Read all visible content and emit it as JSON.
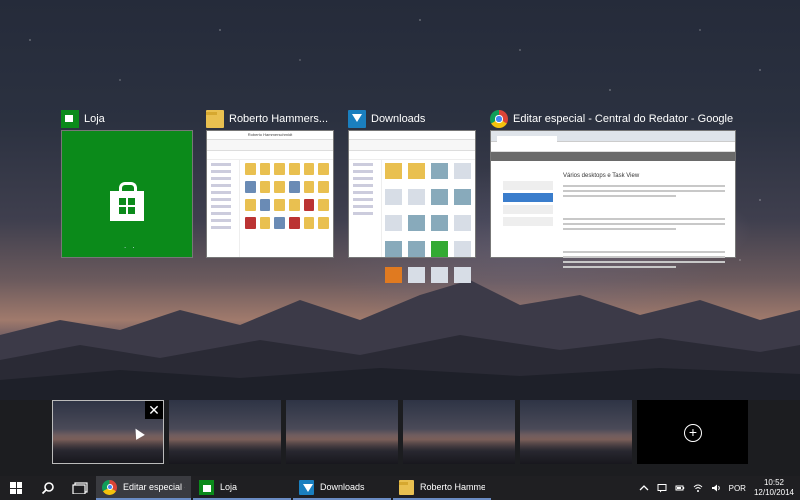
{
  "windows": [
    {
      "title": "Loja",
      "icon": "store-icon"
    },
    {
      "title": "Roberto Hammers...",
      "icon": "folder-icon",
      "window_title": "Roberto Hammerschmidt"
    },
    {
      "title": "Downloads",
      "icon": "downloads-folder-icon"
    },
    {
      "title": "Editar especial - Central do Redator - Google Ch...",
      "icon": "chrome-icon",
      "heading": "Vários desktops e Task View"
    }
  ],
  "desktops": {
    "count": 5,
    "active_index": 0,
    "close_symbol": "✕",
    "add_symbol": "+"
  },
  "taskbar": {
    "apps": [
      {
        "label": "Editar especial - C...",
        "icon": "chrome-icon",
        "active": true
      },
      {
        "label": "Loja",
        "icon": "store-icon",
        "active": false
      },
      {
        "label": "Downloads",
        "icon": "downloads-folder-icon",
        "active": false
      },
      {
        "label": "Roberto Hammer...",
        "icon": "folder-icon",
        "active": false
      }
    ],
    "tray": {
      "language": "POR",
      "time": "10:52",
      "date": "12/10/2014"
    }
  }
}
